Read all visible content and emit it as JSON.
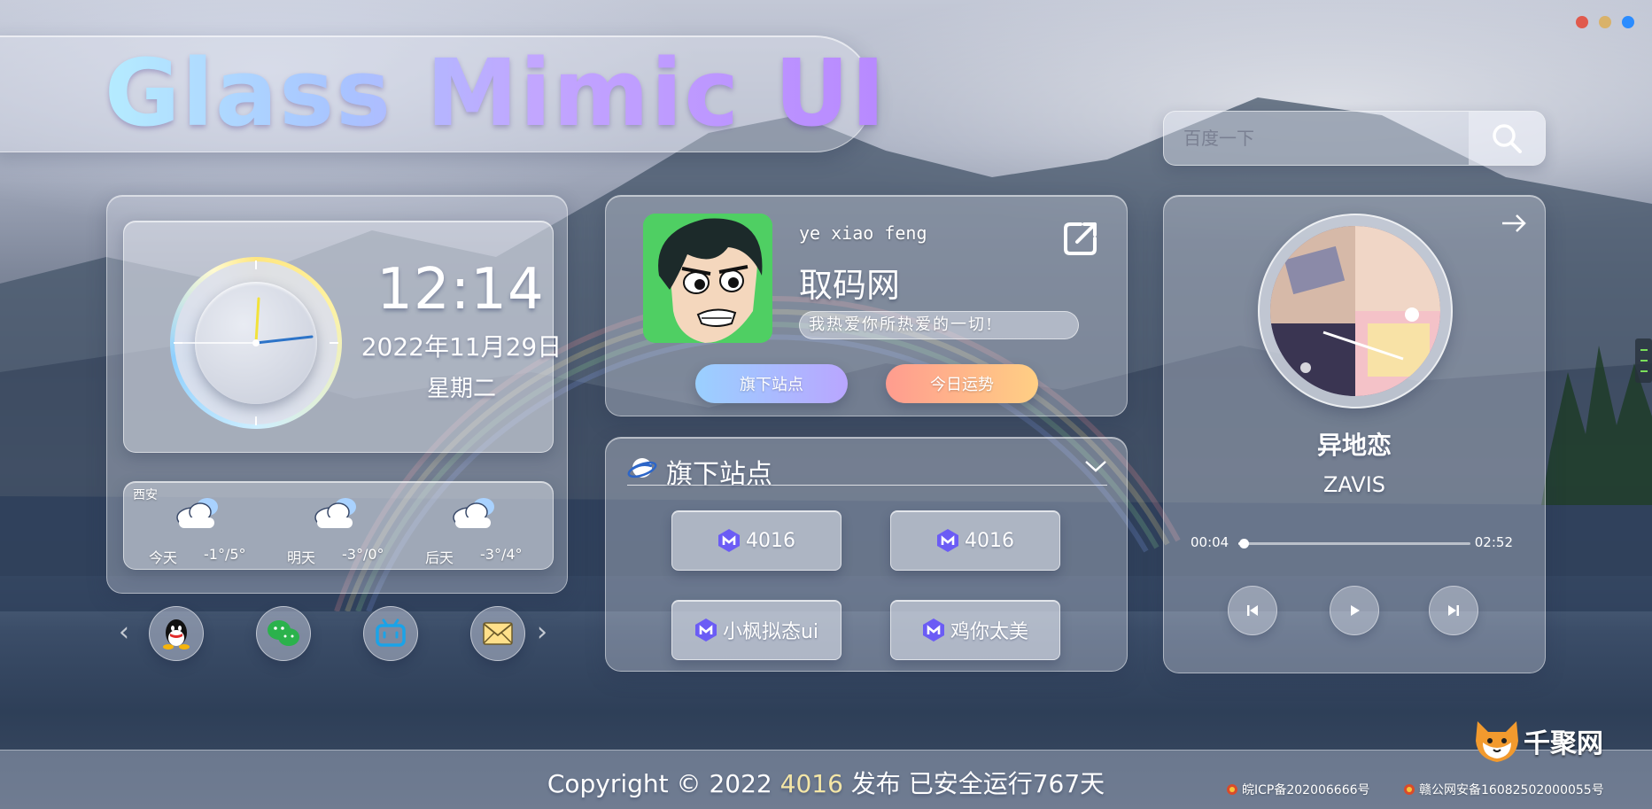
{
  "window": {
    "dot_colors": [
      "#e05a4d",
      "#d9b26a",
      "#2b8cff"
    ]
  },
  "header": {
    "title": "Glass Mimic UI"
  },
  "search": {
    "placeholder": "百度一下"
  },
  "clock": {
    "time": "12:14",
    "date": "2022年11月29日",
    "weekday": "星期二"
  },
  "weather": {
    "city": "西安",
    "days": [
      {
        "label": "今天",
        "temp": "-1°/5°",
        "icon": "cloudy-icon"
      },
      {
        "label": "明天",
        "temp": "-3°/0°",
        "icon": "cloudy-icon"
      },
      {
        "label": "后天",
        "temp": "-3°/4°",
        "icon": "cloudy-icon"
      }
    ]
  },
  "social": [
    {
      "name": "qq-icon"
    },
    {
      "name": "wechat-icon"
    },
    {
      "name": "bilibili-icon"
    },
    {
      "name": "mail-icon"
    }
  ],
  "profile": {
    "name": "ye xiao feng",
    "site": "取码网",
    "motto": "我热爱你所热爱的一切!",
    "btn_sites": "旗下站点",
    "btn_fortune": "今日运势"
  },
  "sites": {
    "title": "旗下站点",
    "items": [
      {
        "label": "4016"
      },
      {
        "label": "4016"
      },
      {
        "label": "小枫拟态ui"
      },
      {
        "label": "鸡你太美"
      }
    ]
  },
  "music": {
    "song": "异地恋",
    "artist": "ZAVIS",
    "current": "00:04",
    "duration": "02:52",
    "progress": 0.023
  },
  "footer": {
    "copy_prefix": "Copyright © 2022",
    "copy_brand": "4016",
    "copy_suffix": "发布 已安全运行767天",
    "icp": "皖ICP备202006666号",
    "police": "赣公网安备16082502000055号",
    "watermark": "千聚网"
  }
}
